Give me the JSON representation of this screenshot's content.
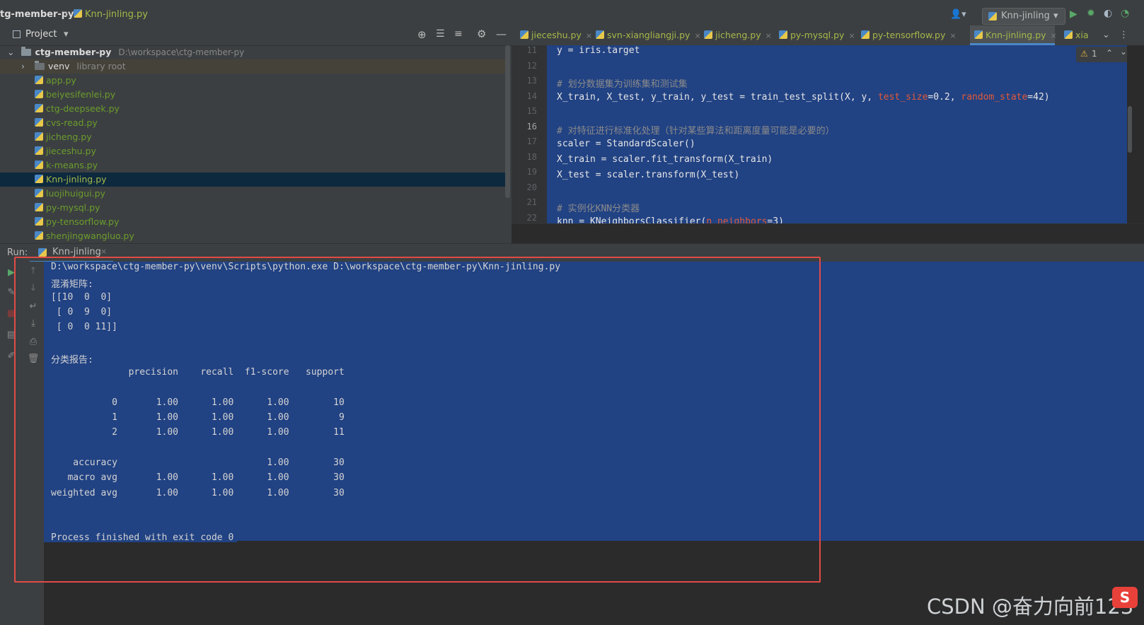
{
  "navbar": {
    "project": "tg-member-py",
    "file": "Knn-jinling.py",
    "run_config": "Knn-jinling"
  },
  "project_pane": {
    "title": "Project",
    "root_name": "ctg-member-py",
    "root_path": "D:\\workspace\\ctg-member-py",
    "venv_name": "venv",
    "venv_label": "library root",
    "files": [
      "app.py",
      "beiyesifenlei.py",
      "ctg-deepseek.py",
      "cvs-read.py",
      "jicheng.py",
      "jieceshu.py",
      "k-means.py",
      "Knn-jinling.py",
      "luojihuigui.py",
      "py-mysql.py",
      "py-tensorflow.py",
      "shenjingwangluo.py"
    ],
    "selected_file": "Knn-jinling.py"
  },
  "editor": {
    "tabs": [
      "jieceshu.py",
      "svn-xiangliangji.py",
      "jicheng.py",
      "py-mysql.py",
      "py-tensorflow.py",
      "Knn-jinling.py",
      "xia"
    ],
    "active_tab": "Knn-jinling.py",
    "warning_count": "1",
    "line_numbers": [
      "11",
      "12",
      "13",
      "14",
      "15",
      "16",
      "17",
      "18",
      "19",
      "20",
      "21",
      "22"
    ],
    "current_line": "16",
    "lines": {
      "l11": "y = iris.target",
      "l13": "# 划分数据集为训练集和测试集",
      "l14a": "X_train, X_test, y_train, y_test = train_test_split(X, y, ",
      "l14p1": "test_size",
      "l14v1": "=0.2, ",
      "l14p2": "random_state",
      "l14v2": "=42)",
      "l16": "# 对特征进行标准化处理（针对某些算法和距离度量可能是必要的）",
      "l17": "scaler = StandardScaler()",
      "l18": "X_train = scaler.fit_transform(X_train)",
      "l19": "X_test = scaler.transform(X_test)",
      "l21": "# 实例化KNN分类器",
      "l22a": "knn = KNeighborsClassifier(",
      "l22p": "n_neighbors",
      "l22v": "=3)"
    }
  },
  "run_panel": {
    "label": "Run:",
    "tab": "Knn-jinling",
    "output": [
      "D:\\workspace\\ctg-member-py\\venv\\Scripts\\python.exe D:\\workspace\\ctg-member-py\\Knn-jinling.py",
      "混淆矩阵:",
      "[[10  0  0]",
      " [ 0  9  0]",
      " [ 0  0 11]]",
      "",
      "分类报告:",
      "              precision    recall  f1-score   support",
      "",
      "           0       1.00      1.00      1.00        10",
      "           1       1.00      1.00      1.00         9",
      "           2       1.00      1.00      1.00        11",
      "",
      "    accuracy                           1.00        30",
      "   macro avg       1.00      1.00      1.00        30",
      "weighted avg       1.00      1.00      1.00        30",
      "",
      "",
      "Process finished with exit code 0"
    ]
  },
  "watermark": "CSDN @奋力向前123",
  "colors": {
    "accent": "#4a88c7",
    "selection": "#214283",
    "highlight_box": "#e04b47"
  }
}
